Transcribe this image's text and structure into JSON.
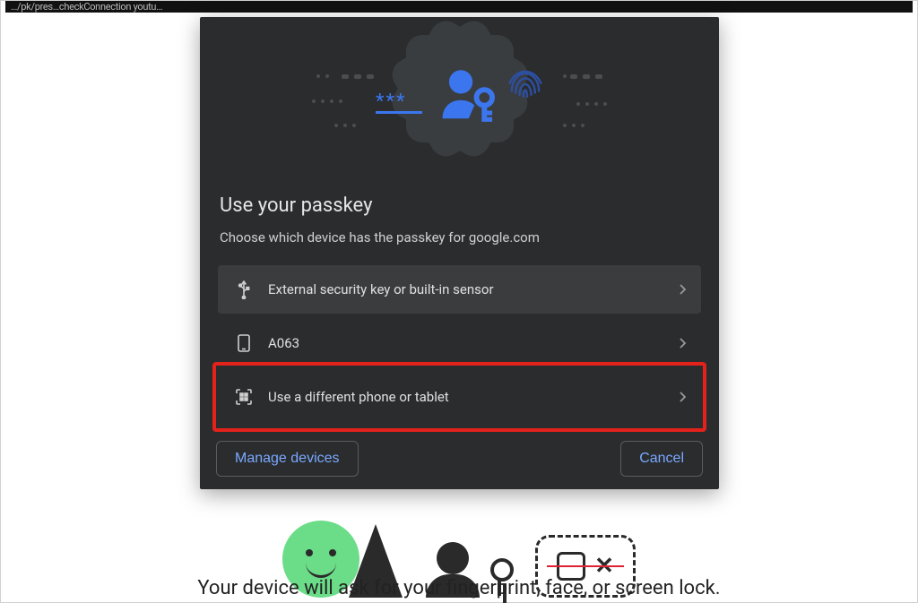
{
  "address_bar": "…/pk/pres…checkConnection  youtu…",
  "dialog": {
    "title": "Use your passkey",
    "subtitle": "Choose which device has the passkey for google.com",
    "options": [
      {
        "icon": "usb-icon",
        "label": "External security key or built-in sensor",
        "selected": true,
        "highlighted": false
      },
      {
        "icon": "phone-icon",
        "label": "A063",
        "selected": false,
        "highlighted": false
      },
      {
        "icon": "qr-icon",
        "label": "Use a different phone or tablet",
        "selected": false,
        "highlighted": true
      }
    ],
    "actions": {
      "manage": "Manage devices",
      "cancel": "Cancel"
    }
  },
  "page_caption": "Your device will ask for your fingerprint, face, or screen lock."
}
